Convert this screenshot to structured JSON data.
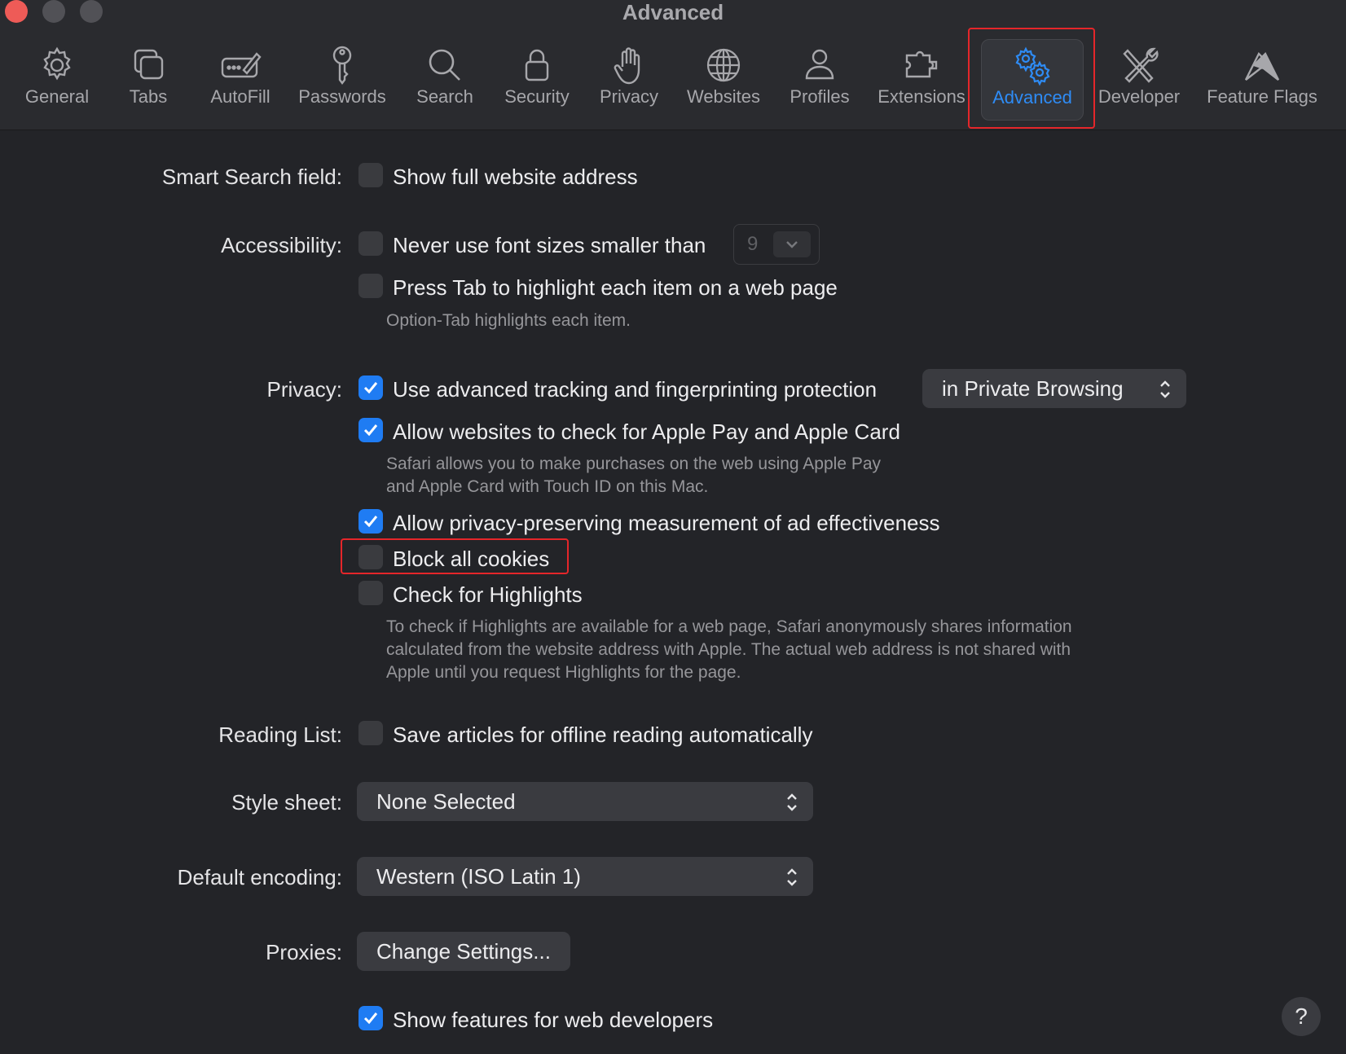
{
  "window": {
    "title": "Advanced"
  },
  "toolbar": {
    "items": [
      {
        "label": "General",
        "icon": "gear-icon"
      },
      {
        "label": "Tabs",
        "icon": "tabs-icon"
      },
      {
        "label": "AutoFill",
        "icon": "autofill-icon"
      },
      {
        "label": "Passwords",
        "icon": "key-icon"
      },
      {
        "label": "Search",
        "icon": "search-icon"
      },
      {
        "label": "Security",
        "icon": "lock-icon"
      },
      {
        "label": "Privacy",
        "icon": "hand-icon"
      },
      {
        "label": "Websites",
        "icon": "globe-icon"
      },
      {
        "label": "Profiles",
        "icon": "person-icon"
      },
      {
        "label": "Extensions",
        "icon": "puzzle-icon"
      },
      {
        "label": "Advanced",
        "icon": "gears-icon",
        "active": true
      },
      {
        "label": "Developer",
        "icon": "tools-icon"
      },
      {
        "label": "Feature Flags",
        "icon": "flags-icon"
      }
    ],
    "active_color": "#2e8cf6"
  },
  "smart_search": {
    "label": "Smart Search field:",
    "show_full_address": {
      "text": "Show full website address",
      "checked": false
    }
  },
  "accessibility": {
    "label": "Accessibility:",
    "font_size": {
      "text": "Never use font sizes smaller than",
      "checked": false,
      "value": "9"
    },
    "press_tab": {
      "text": "Press Tab to highlight each item on a web page",
      "checked": false
    },
    "help": "Option-Tab highlights each item."
  },
  "privacy": {
    "label": "Privacy:",
    "tracking": {
      "text": "Use advanced tracking and fingerprinting protection",
      "checked": true,
      "select_value": "in Private Browsing"
    },
    "apple_pay": {
      "text": "Allow websites to check for Apple Pay and Apple Card",
      "checked": true
    },
    "apple_pay_help_1": "Safari allows you to make purchases on the web using Apple Pay",
    "apple_pay_help_2": "and Apple Card with Touch ID on this Mac.",
    "ad_measurement": {
      "text": "Allow privacy-preserving measurement of ad effectiveness",
      "checked": true
    },
    "block_cookies": {
      "text": "Block all cookies",
      "checked": false
    },
    "highlights": {
      "text": "Check for Highlights",
      "checked": false
    },
    "highlights_help_1": "To check if Highlights are available for a web page, Safari anonymously shares information",
    "highlights_help_2": "calculated from the website address with Apple. The actual web address is not shared with",
    "highlights_help_3": "Apple until you request Highlights for the page."
  },
  "reading_list": {
    "label": "Reading List:",
    "save_offline": {
      "text": "Save articles for offline reading automatically",
      "checked": false
    }
  },
  "style_sheet": {
    "label": "Style sheet:",
    "value": "None Selected"
  },
  "encoding": {
    "label": "Default encoding:",
    "value": "Western (ISO Latin 1)"
  },
  "proxies": {
    "label": "Proxies:",
    "button": "Change Settings..."
  },
  "developer": {
    "text": "Show features for web developers",
    "checked": true
  },
  "help_button": "?",
  "colors": {
    "checkbox_checked": "#1f7cf3",
    "highlight_border": "#e5262a"
  }
}
